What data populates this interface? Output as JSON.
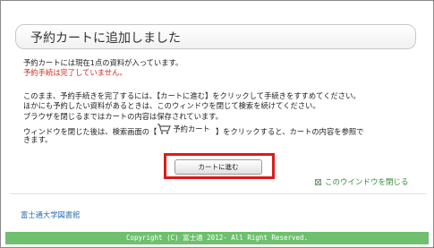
{
  "header": {
    "title": "予約カートに追加しました"
  },
  "status": {
    "count_line": "予約カートには現在1点の資料が入っています。",
    "warning_line": "予約手続は完了していません。"
  },
  "instructions": {
    "line1": "このまま、予約手続きを完了するには、【カートに進む】をクリックして手続きをすすめてください。",
    "line2": "ほかにも予約したい資料があるときは、このウィンドウを閉じて検索を続けてください。",
    "line3": "ブラウザを閉じるまではカートの内容は保存されています。",
    "line4_before": "ウィンドウを閉じた後は、検索画面の【",
    "line4_cart_label": "予約カート",
    "line4_after": "】をクリックすると、カートの内容を参照で",
    "line5": "きます。"
  },
  "actions": {
    "proceed_label": "カートに進む",
    "close_window_label": "このウインドウを閉じる"
  },
  "footer": {
    "library_name": "富士通大学図書館",
    "copyright": "Copyright (C) 富士通 2012- All Right Reserved."
  },
  "colors": {
    "warning": "#d9261c",
    "highlight_border": "#dd1a1a",
    "link_green": "#3a8a3a",
    "library_blue": "#2a6db0",
    "footer_green": "#6ec06e"
  },
  "icons": [
    "cart-icon",
    "close-icon"
  ]
}
